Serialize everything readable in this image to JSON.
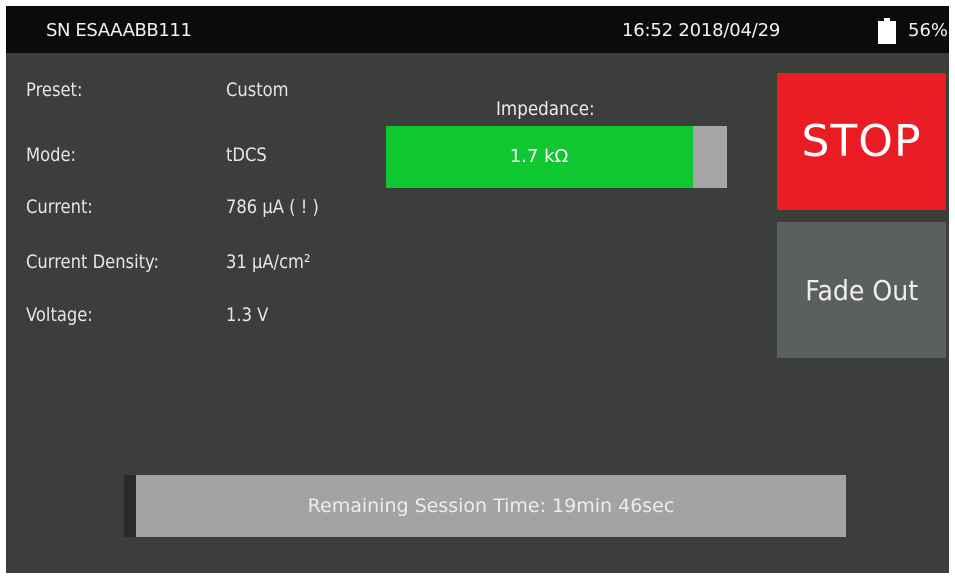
{
  "status_bar": {
    "serial": "SN ESAAABB111",
    "datetime": "16:52 2018/04/29",
    "battery_percent": "56%",
    "battery_icon": "battery-icon"
  },
  "info": {
    "preset_label": "Preset:",
    "preset_value": "Custom",
    "mode_label": "Mode:",
    "mode_value": "tDCS",
    "current_label": "Current:",
    "current_value": "786 µA ( ! )",
    "density_label": "Current Density:",
    "density_value": "31 µA/cm²",
    "voltage_label": "Voltage:",
    "voltage_value": "1.3 V"
  },
  "impedance": {
    "label": "Impedance:",
    "value": "1.7 kΩ",
    "level_fraction": 0.9
  },
  "buttons": {
    "stop": "STOP",
    "fade_out": "Fade Out"
  },
  "session": {
    "remaining": "Remaining Session Time: 19min 46sec"
  },
  "colors": {
    "background": "#3c3e3c",
    "status_bar": "#0b0b0b",
    "impedance_good": "#0fc731",
    "stop_red": "#ec1c24",
    "secondary_button": "#5c605d",
    "session_bar": "#a3a3a3"
  }
}
